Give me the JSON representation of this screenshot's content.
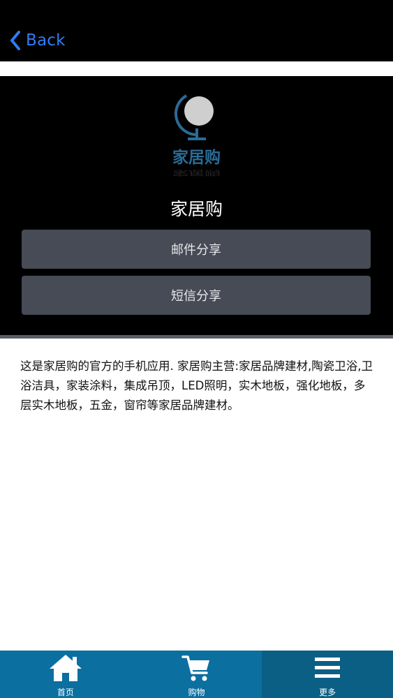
{
  "nav": {
    "back_label": "Back"
  },
  "share": {
    "logo_text": "家居购",
    "app_name": "家居购",
    "mail_label": "邮件分享",
    "sms_label": "短信分享"
  },
  "description": "这是家居购的官方的手机应用. 家居购主营:家居品牌建材,陶瓷卫浴,卫浴洁具，家装涂料，集成吊顶，LED照明，实木地板，强化地板，多层实木地板，五金，窗帘等家居品牌建材。",
  "tabs": [
    {
      "label": "首页",
      "icon": "home-icon"
    },
    {
      "label": "购物",
      "icon": "cart-icon"
    },
    {
      "label": "更多",
      "icon": "menu-icon"
    }
  ],
  "colors": {
    "accent": "#2f7df6",
    "tab_bar": "#0b6fa0",
    "tab_active": "#0b5f84",
    "share_button": "#474b55"
  }
}
